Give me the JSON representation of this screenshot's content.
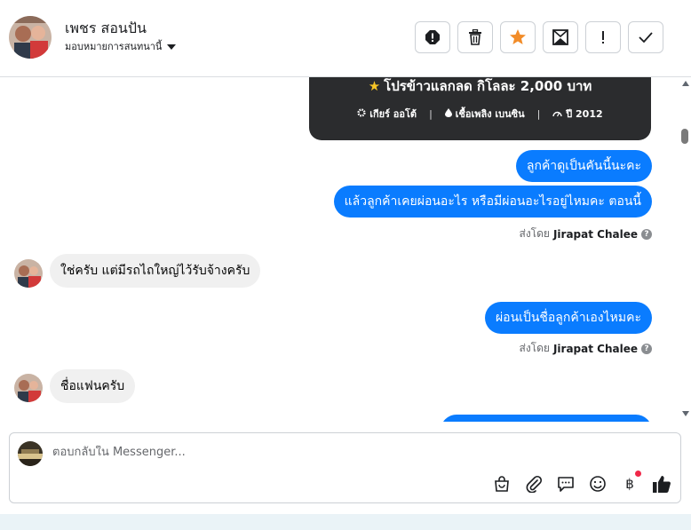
{
  "header": {
    "name": "เพชร สอนปัน",
    "subtitle": "มอบหมายการสนทนานี้",
    "tools": [
      "report-icon",
      "trash-icon",
      "star-icon",
      "mark-unread-icon",
      "exclamation-icon",
      "check-icon"
    ],
    "star_color": "#f28c28"
  },
  "card": {
    "title": "โปรข้าวแลกลด กิโลละ 2,000 บาท",
    "gear": "เกียร์ ออโต้",
    "fuel": "เชื้อเพลิง เบนซิน",
    "year": "ปี 2012"
  },
  "messages": {
    "m1": "ลูกค้าดูเป็นคันนี้นะคะ",
    "m2": "แล้วลูกค้าเคยผ่อนอะไร หรือมีผ่อนอะไรอยู่ไหมคะ ตอนนี้",
    "m3": "ใช่ครับ  แต่มีรถไถใหญ่ไว้รับจ้างครับ",
    "m4": "ผ่อนเป็นชื่อลูกค้าเองไหมคะ",
    "m5": "ชื่อแฟนครับ",
    "sent_by_prefix": "ส่งโดย",
    "sent_by_name": "Jirapat Chalee",
    "help": "?"
  },
  "composer": {
    "placeholder": "ตอบกลับใน Messenger...",
    "baht": "฿",
    "tools": [
      "bag-icon",
      "paperclip-icon",
      "chat-icon",
      "emoji-icon",
      "baht-icon",
      "like-icon"
    ]
  },
  "colors": {
    "outgoing": "#0a7cff",
    "incoming": "#f0f0f0",
    "card_bg": "#2b2c2e"
  }
}
